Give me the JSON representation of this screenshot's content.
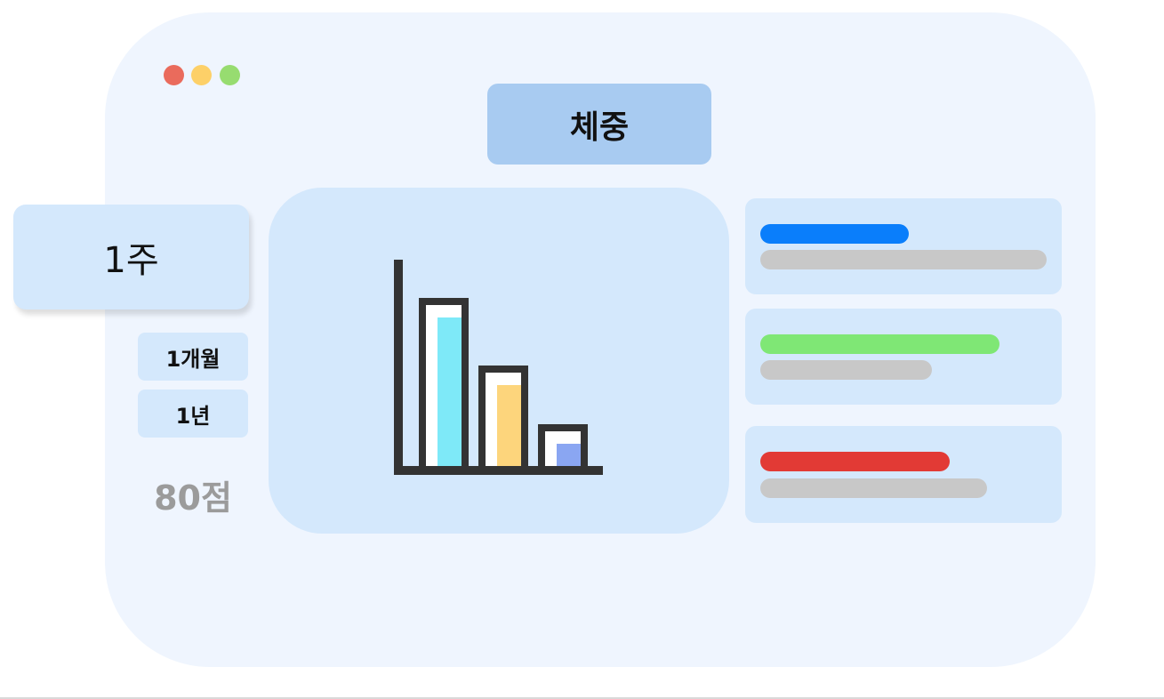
{
  "window": {
    "controls": [
      "close",
      "minimize",
      "maximize"
    ],
    "colors": {
      "close": "#ea6b5c",
      "minimize": "#fdd068",
      "maximize": "#97dc70"
    }
  },
  "header": {
    "title": "체중"
  },
  "periods": {
    "week": "1주",
    "month": "1개월",
    "year": "1년",
    "selected": "week"
  },
  "score": {
    "label": "80점"
  },
  "chart_data": {
    "type": "bar",
    "values": [
      1.0,
      0.6,
      0.25
    ],
    "colors": [
      "#7ee9f8",
      "#fdd57c",
      "#8aa6f2"
    ]
  },
  "stats": [
    {
      "accent": "#0a7efb",
      "accent_fraction": 0.52,
      "track_fraction": 1.0
    },
    {
      "accent": "#7fe775",
      "accent_fraction": 0.88,
      "track_fraction": 0.6
    },
    {
      "accent": "#e23a35",
      "accent_fraction": 0.85,
      "track_fraction": 0.85
    }
  ]
}
